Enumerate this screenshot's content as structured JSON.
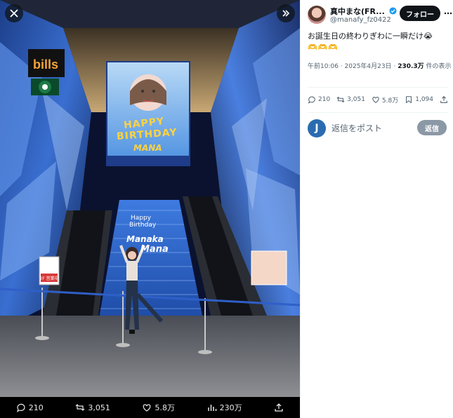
{
  "media_viewer": {
    "stats": {
      "replies": "210",
      "reposts": "3,051",
      "likes": "5.8万",
      "views": "230万"
    },
    "photo": {
      "sign_brand": "bills",
      "banner_line1": "HAPPY",
      "banner_line2": "BIRTHDAY",
      "banner_line3": "MANA",
      "stairs_line1": "Happy",
      "stairs_line2": "Birthday",
      "stairs_line3": "Manaka",
      "stairs_line4": "Mana",
      "floor_sign": "2F 営業中"
    }
  },
  "tweet": {
    "author_name": "真中まな(FR...",
    "author_handle": "@manafy_fz0422",
    "follow_label": "フォロー",
    "text": "お誕生日の終わりぎわに一瞬だけ",
    "text_emoji": "😭",
    "hearts": "🫶🫶🫶",
    "time": "午前10:06 · 2025年4月23日 ·",
    "views_count": "230.3万",
    "views_suffix": "件の表示",
    "actions": {
      "replies": "210",
      "reposts": "3,051",
      "likes": "5.8万",
      "bookmarks": "1,094"
    },
    "reply_placeholder": "返信をポスト",
    "reply_button": "返信",
    "me_avatar_letter": "J"
  }
}
